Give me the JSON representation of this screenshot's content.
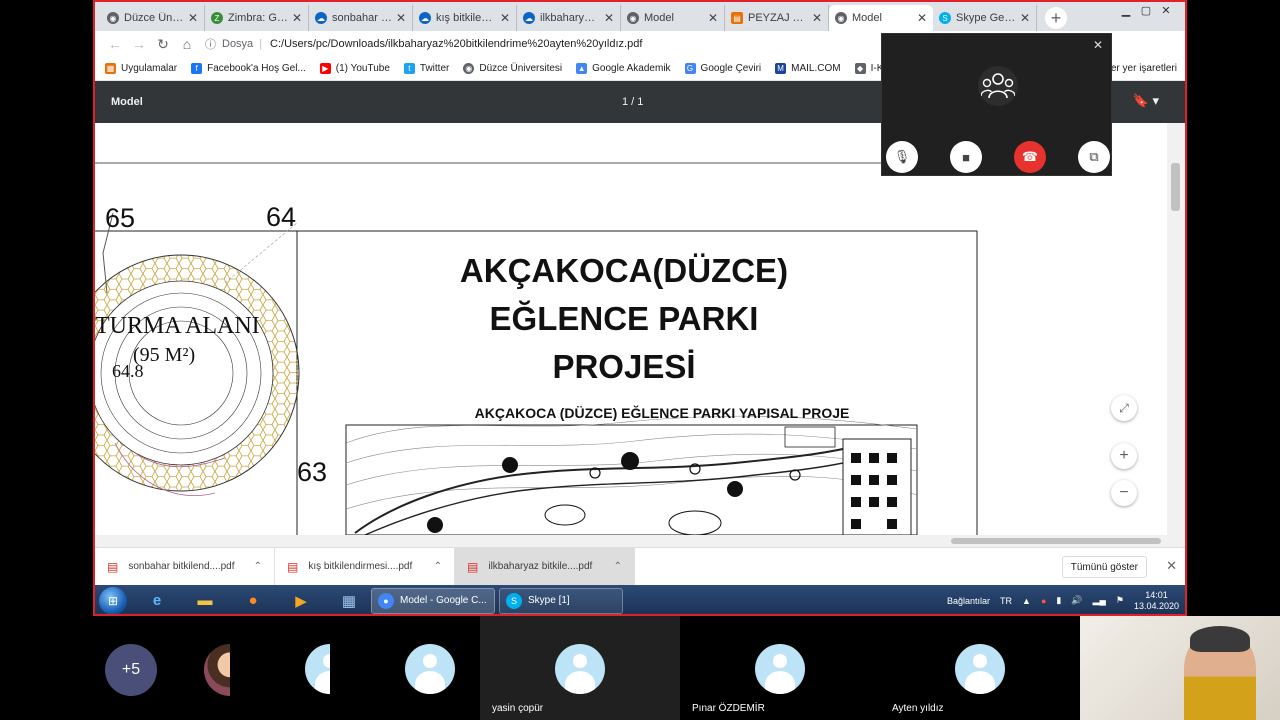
{
  "browser": {
    "tabs": [
      {
        "title": "Düzce Üniv...",
        "color": "#5f6368",
        "icon": "globe-icon",
        "active": false
      },
      {
        "title": "Zimbra: Gel...",
        "color": "#3a8e3a",
        "icon": "zimbra-icon",
        "active": false
      },
      {
        "title": "sonbahar bi...",
        "color": "#0a66c2",
        "icon": "onedrive-icon",
        "active": false
      },
      {
        "title": "kış bitkilend...",
        "color": "#0a66c2",
        "icon": "onedrive-icon",
        "active": false
      },
      {
        "title": "ilkbaharyaz...",
        "color": "#0a66c2",
        "icon": "onedrive-icon",
        "active": false
      },
      {
        "title": "Model",
        "color": "#5f6368",
        "icon": "globe-icon",
        "active": false
      },
      {
        "title": "PEYZAJ TAS...",
        "color": "#e8710a",
        "icon": "document-icon",
        "active": false
      },
      {
        "title": "Model",
        "color": "#5f6368",
        "icon": "globe-icon",
        "active": true
      },
      {
        "title": "Skype Geri...",
        "color": "#00aff0",
        "icon": "skype-icon",
        "active": false
      }
    ],
    "address": {
      "security_label": "Dosya",
      "url": "C:/Users/pc/Downloads/ilkbaharyaz%20bitkilendrime%20ayten%20yıldız.pdf"
    },
    "bookmarks": [
      {
        "label": "Uygulamalar",
        "color": "#e8710a"
      },
      {
        "label": "Facebook'a Hoş Gel...",
        "color": "#1877f2"
      },
      {
        "label": "(1) YouTube",
        "color": "#ff0000"
      },
      {
        "label": "Twitter",
        "color": "#1da1f2"
      },
      {
        "label": "Düzce Üniversitesi",
        "color": "#5f6368"
      },
      {
        "label": "Google Akademik",
        "color": "#4285f4"
      },
      {
        "label": "Google Çeviri",
        "color": "#4285f4"
      },
      {
        "label": "MAIL.COM",
        "color": "#1c449b"
      },
      {
        "label": "I-KO",
        "color": "#5f6368"
      }
    ],
    "bookmarks_other": "er yer işaretleri"
  },
  "pdf": {
    "title": "Model",
    "page_indicator": "1 / 1",
    "numbers": [
      "65",
      "64",
      "63"
    ],
    "circle_title": "TURMA ALANI",
    "circle_sub": "(95 M²)",
    "circle_num": "64.8",
    "heading_line1": "AKÇAKOCA(DÜZCE)",
    "heading_line2": "EĞLENCE PARKI",
    "heading_line3": "PROJESİ",
    "subheading": "AKÇAKOCA (DÜZCE) EĞLENCE PARKI YAPISAL PROJE"
  },
  "downloads": {
    "items": [
      {
        "name": "sonbahar bitkilend....pdf"
      },
      {
        "name": "kış bitkilendirmesi....pdf"
      },
      {
        "name": "ilkbaharyaz bitkile....pdf"
      }
    ],
    "show_all": "Tümünü göster"
  },
  "taskbar": {
    "tasks": [
      {
        "label": "Model - Google C...",
        "color": "#4285f4"
      },
      {
        "label": "Skype [1]",
        "color": "#00aff0"
      }
    ],
    "tray_label": "Bağlantılar",
    "lang": "TR",
    "time": "14:01",
    "date": "13.04.2020"
  },
  "participants": {
    "extra": "+5",
    "names": [
      "yasin çopür",
      "Pınar ÖZDEMİR",
      "Ayten yıldız"
    ]
  }
}
